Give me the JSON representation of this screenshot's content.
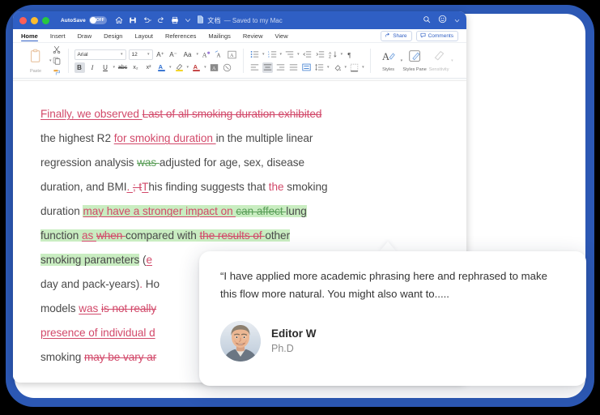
{
  "window": {
    "titlebar": {
      "autosave_label": "AutoSave",
      "autosave_state": "OFF",
      "doc_name": "文档",
      "saved_status": "— Saved to my Mac",
      "quick_access": [
        "home-icon",
        "save-icon",
        "undo-icon",
        "redo-icon",
        "print-icon",
        "customize-icon"
      ],
      "right_icons": [
        "search-icon",
        "account-icon"
      ]
    },
    "ribbon_tabs": {
      "items": [
        {
          "label": "Home",
          "active": true
        },
        {
          "label": "Insert",
          "active": false
        },
        {
          "label": "Draw",
          "active": false
        },
        {
          "label": "Design",
          "active": false
        },
        {
          "label": "Layout",
          "active": false
        },
        {
          "label": "References",
          "active": false
        },
        {
          "label": "Mailings",
          "active": false
        },
        {
          "label": "Review",
          "active": false
        },
        {
          "label": "View",
          "active": false
        }
      ],
      "share_label": "Share",
      "comments_label": "Comments"
    },
    "ribbon": {
      "paste_label": "Paste",
      "font_name": "Arial",
      "font_size": "12",
      "styles_label": "Styles",
      "styles_pane_label": "Styles Pane",
      "sensitivity_label": "Sensitivity"
    }
  },
  "document": {
    "runs": [
      {
        "text": "Finally, we observed ",
        "style": "ins"
      },
      {
        "text": "Last of all smoking duration exhibited ",
        "style": "del"
      },
      {
        "text": "the highest R2 ",
        "style": "plain"
      },
      {
        "text": "for smoking duration ",
        "style": "ins"
      },
      {
        "text": "in the multiple linear regression analysis ",
        "style": "plain"
      },
      {
        "text": "was ",
        "style": "del-green"
      },
      {
        "text": "adjusted for age, sex, disease duration, and BMI",
        "style": "plain"
      },
      {
        "text": ". ",
        "style": "ins"
      },
      {
        "text": "; t",
        "style": "del"
      },
      {
        "text": "T",
        "style": "ins"
      },
      {
        "text": "his finding suggests that ",
        "style": "plain"
      },
      {
        "text": "the ",
        "style": "ins-nu"
      },
      {
        "text": "smoking duration ",
        "style": "plain"
      },
      {
        "text": "may have a stronger impact on ",
        "style": "ins-hl"
      },
      {
        "text": "can affect ",
        "style": "del-green-hl"
      },
      {
        "text": "lung function ",
        "style": "plain-hl"
      },
      {
        "text": "as ",
        "style": "ins-hl"
      },
      {
        "text": "when ",
        "style": "del-hl"
      },
      {
        "text": "compared with ",
        "style": "plain-hl"
      },
      {
        "text": "the results of ",
        "style": "del-hl"
      },
      {
        "text": "other smoking parameters",
        "style": "plain-hl"
      },
      {
        "text": " (e",
        "style": "plain"
      },
      {
        "text": "day and pack-years)",
        "style": "plain"
      },
      {
        "text": ". Ho",
        "style": "plain"
      },
      {
        "text": "models ",
        "style": "plain"
      },
      {
        "text": "was ",
        "style": "ins"
      },
      {
        "text": "is not really",
        "style": "del"
      },
      {
        "text": "presence of individual d",
        "style": "ins"
      },
      {
        "text": "smoking ",
        "style": "plain"
      },
      {
        "text": "may be vary ar",
        "style": "del"
      }
    ],
    "lines": [
      [
        {
          "t": "Finally, we observed ",
          "s": "ins"
        },
        {
          "t": "Last of all smoking duration exhibited",
          "s": "del"
        }
      ],
      [
        {
          "t": "the highest R2 ",
          "s": "plain"
        },
        {
          "t": "for smoking duration ",
          "s": "ins"
        },
        {
          "t": "in the multiple linear",
          "s": "plain"
        }
      ],
      [
        {
          "t": "regression analysis ",
          "s": "plain"
        },
        {
          "t": "was ",
          "s": "del-green"
        },
        {
          "t": "adjusted for age, sex, disease",
          "s": "plain"
        }
      ],
      [
        {
          "t": "duration, and BMI",
          "s": "plain"
        },
        {
          "t": ". ",
          "s": "ins"
        },
        {
          "t": "; t",
          "s": "del"
        },
        {
          "t": "T",
          "s": "ins"
        },
        {
          "t": "his finding suggests that ",
          "s": "plain"
        },
        {
          "t": "the ",
          "s": "ins-nu"
        },
        {
          "t": "smoking",
          "s": "plain"
        }
      ],
      [
        {
          "t": "duration ",
          "s": "plain"
        },
        {
          "t": "may have a stronger impact on ",
          "s": "ins-hl"
        },
        {
          "t": "can affect ",
          "s": "del-green-hl"
        },
        {
          "t": "lung",
          "s": "plain-hl"
        }
      ],
      [
        {
          "t": "function ",
          "s": "plain-hl"
        },
        {
          "t": "as ",
          "s": "ins-hl"
        },
        {
          "t": "when ",
          "s": "del-hl"
        },
        {
          "t": "compared with ",
          "s": "plain-hl"
        },
        {
          "t": "the results of ",
          "s": "del-hl"
        },
        {
          "t": "other",
          "s": "plain-hl"
        }
      ],
      [
        {
          "t": "smoking parameters",
          "s": "plain-hl"
        },
        {
          "t": "  (",
          "s": "plain"
        },
        {
          "t": "e",
          "s": "ins"
        }
      ],
      [
        {
          "t": "day and pack-years)",
          "s": "plain"
        },
        {
          "t": ". ",
          "s": "ins-nu"
        },
        {
          "t": "Ho",
          "s": "plain"
        }
      ],
      [
        {
          "t": "models ",
          "s": "plain"
        },
        {
          "t": "was ",
          "s": "ins"
        },
        {
          "t": "is not really",
          "s": "del"
        }
      ],
      [
        {
          "t": "presence of individual d",
          "s": "ins"
        }
      ],
      [
        {
          "t": "smoking ",
          "s": "plain"
        },
        {
          "t": "may be vary ar",
          "s": "del"
        }
      ]
    ]
  },
  "comment_card": {
    "quote": "“I have applied more academic phrasing here and rephrased to make this flow more natural. You might also want to.....",
    "author_name": "Editor W",
    "author_title": "Ph.D",
    "avatar": "editor-avatar-photo"
  },
  "colors": {
    "frame_blue": "#2c58b4",
    "titlebar_blue": "#2f5fc4",
    "insert_red": "#d2496a",
    "delete_green": "#5a9e58",
    "highlight_green": "#c9edc1",
    "body_text": "#4a4a4a"
  }
}
